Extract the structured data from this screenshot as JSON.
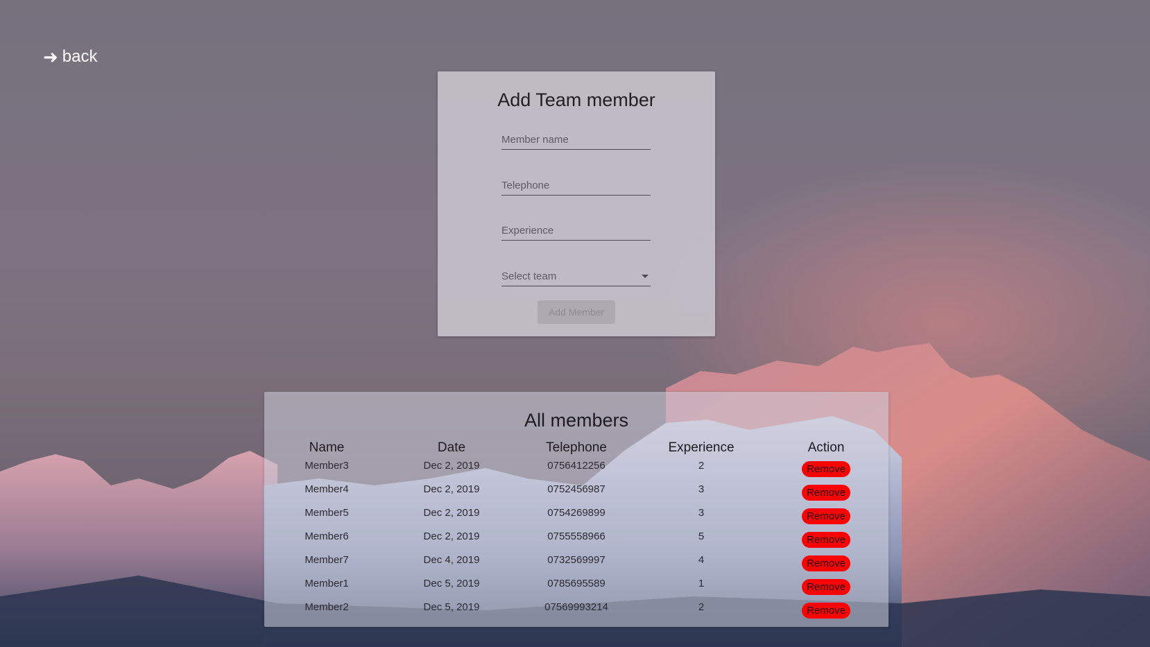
{
  "nav": {
    "back_label": "back",
    "back_icon": "arrow-right-icon"
  },
  "form": {
    "title": "Add Team member",
    "member_name_placeholder": "Member name",
    "telephone_placeholder": "Telephone",
    "experience_placeholder": "Experience",
    "team_select_placeholder": "Select team",
    "submit_label": "Add Member"
  },
  "members": {
    "title": "All members",
    "columns": [
      "Name",
      "Date",
      "Telephone",
      "Experience",
      "Action"
    ],
    "rows": [
      {
        "name": "Member3",
        "date": "Dec 2, 2019",
        "telephone": "0756412256",
        "experience": "2",
        "action": "Remove"
      },
      {
        "name": "Member4",
        "date": "Dec 2, 2019",
        "telephone": "0752456987",
        "experience": "3",
        "action": "Remove"
      },
      {
        "name": "Member5",
        "date": "Dec 2, 2019",
        "telephone": "0754269899",
        "experience": "3",
        "action": "Remove"
      },
      {
        "name": "Member6",
        "date": "Dec 2, 2019",
        "telephone": "0755558966",
        "experience": "5",
        "action": "Remove"
      },
      {
        "name": "Member7",
        "date": "Dec 4, 2019",
        "telephone": "0732569997",
        "experience": "4",
        "action": "Remove"
      },
      {
        "name": "Member1",
        "date": "Dec 5, 2019",
        "telephone": "0785695589",
        "experience": "1",
        "action": "Remove"
      },
      {
        "name": "Member2",
        "date": "Dec 5, 2019",
        "telephone": "07569993214",
        "experience": "2",
        "action": "Remove"
      }
    ]
  },
  "colors": {
    "remove_button": "#ff0000",
    "form_card": "#c8c5cd",
    "text_dark": "#1f1f24"
  }
}
